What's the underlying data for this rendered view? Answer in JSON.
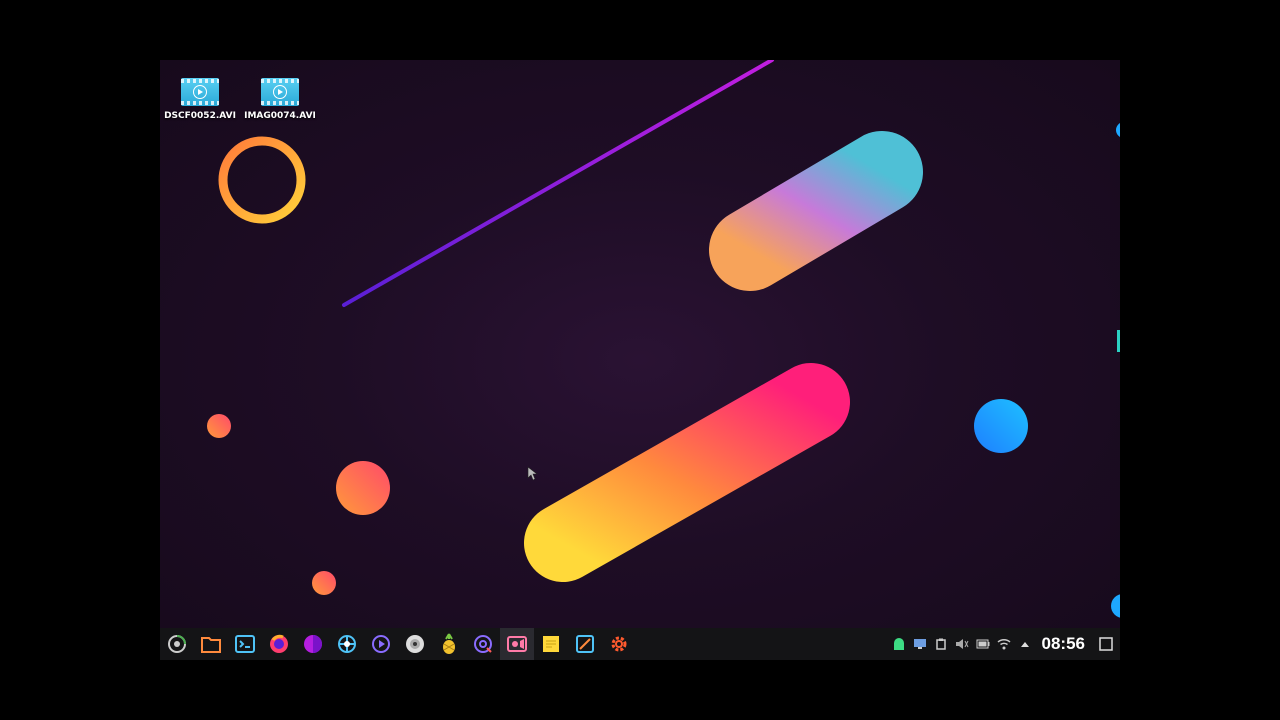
{
  "desktop": {
    "icons": [
      {
        "label": "DSCF0052.AVI",
        "icon": "video-file-icon"
      },
      {
        "label": "IMAG0074.AVI",
        "icon": "video-file-icon"
      }
    ]
  },
  "taskbar": {
    "launchers": [
      {
        "name": "app-menu-icon"
      },
      {
        "name": "file-manager-icon"
      },
      {
        "name": "terminal-icon"
      },
      {
        "name": "firefox-icon"
      },
      {
        "name": "color-picker-icon"
      },
      {
        "name": "network-tool-icon"
      },
      {
        "name": "media-player-icon"
      },
      {
        "name": "disc-burner-icon"
      },
      {
        "name": "pineapple-icon"
      },
      {
        "name": "disk-utility-icon"
      },
      {
        "name": "screen-recorder-icon"
      },
      {
        "name": "sticky-notes-icon"
      },
      {
        "name": "image-editor-icon"
      },
      {
        "name": "settings-icon"
      }
    ],
    "tray": [
      {
        "name": "android-icon"
      },
      {
        "name": "monitor-icon"
      },
      {
        "name": "clipboard-icon"
      },
      {
        "name": "volume-icon"
      },
      {
        "name": "battery-icon"
      },
      {
        "name": "wifi-icon"
      },
      {
        "name": "expand-tray-icon"
      }
    ],
    "clock": "08:56",
    "show_desktop": "show-desktop-icon"
  },
  "colors": {
    "accent_orange": "#ff8a3d",
    "accent_pink": "#ff2d78",
    "accent_yellow": "#ffd93a",
    "accent_blue": "#1e90ff",
    "accent_purple": "#8a2be2"
  }
}
